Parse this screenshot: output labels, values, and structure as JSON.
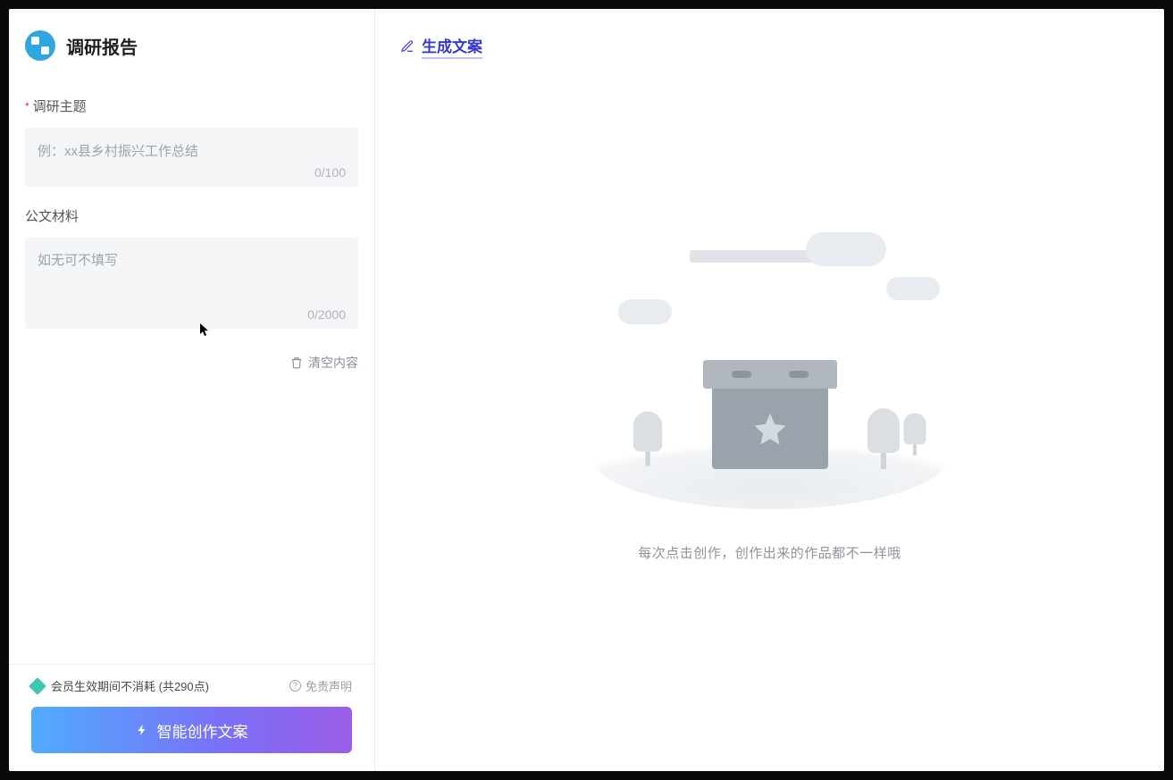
{
  "header": {
    "title": "调研报告"
  },
  "form": {
    "theme": {
      "label": "调研主题",
      "required": true,
      "placeholder": "例：xx县乡村振兴工作总结",
      "value": "",
      "count": "0/100"
    },
    "material": {
      "label": "公文材料",
      "required": false,
      "placeholder": "如无可不填写",
      "value": "",
      "count": "0/2000"
    },
    "clear_label": "清空内容"
  },
  "footer": {
    "points_text": "会员生效期间不消耗 (共290点)",
    "disclaimer_label": "免责声明",
    "generate_label": "智能创作文案"
  },
  "main": {
    "title": "生成文案",
    "empty_text": "每次点击创作，创作出来的作品都不一样哦"
  }
}
